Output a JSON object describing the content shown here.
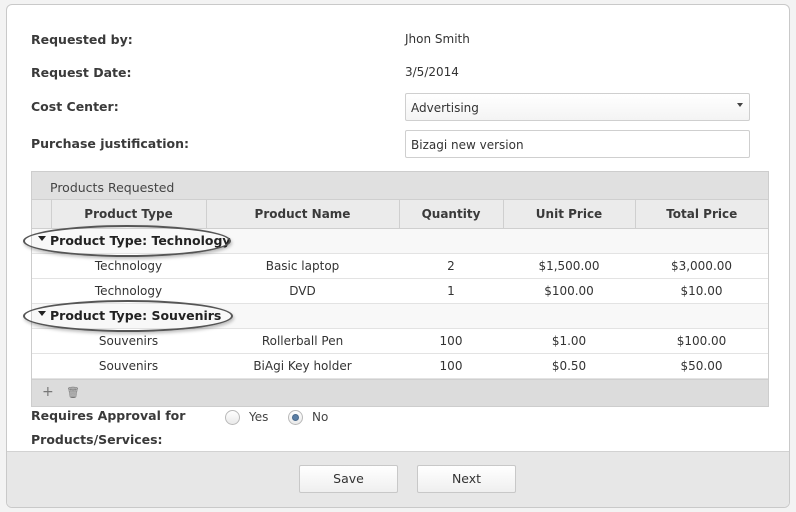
{
  "form": {
    "requested_by": {
      "label": "Requested by:",
      "value": "Jhon Smith"
    },
    "request_date": {
      "label": "Request Date:",
      "value": "3/5/2014"
    },
    "cost_center": {
      "label": "Cost Center:",
      "value": "Advertising"
    },
    "purchase_justification": {
      "label": "Purchase justification:",
      "value": "Bizagi new version"
    }
  },
  "grid": {
    "title": "Products Requested",
    "columns": [
      "Product Type",
      "Product Name",
      "Quantity",
      "Unit Price",
      "Total Price"
    ],
    "groups": [
      {
        "label": "Product Type: Technology",
        "rows": [
          [
            "Technology",
            "Basic laptop",
            "2",
            "$1,500.00",
            "$3,000.00"
          ],
          [
            "Technology",
            "DVD",
            "1",
            "$100.00",
            "$10.00"
          ]
        ]
      },
      {
        "label": "Product Type: Souvenirs",
        "rows": [
          [
            "Souvenirs",
            "Rollerball Pen",
            "100",
            "$1.00",
            "$100.00"
          ],
          [
            "Souvenirs",
            "BiAgi Key holder",
            "100",
            "$0.50",
            "$50.00"
          ]
        ]
      }
    ],
    "toolbar": {
      "add": "+",
      "delete": "🗑"
    }
  },
  "approval": {
    "label_line1": "Requires Approval for",
    "label_line2": "Products/Services:",
    "yes": "Yes",
    "no": "No",
    "selected": "No"
  },
  "buttons": {
    "save": "Save",
    "next": "Next"
  },
  "colors": {
    "radio_selected": "#5a7ea5",
    "header_bg": "#ebebeb",
    "footer_bg": "#e7e7e7"
  }
}
